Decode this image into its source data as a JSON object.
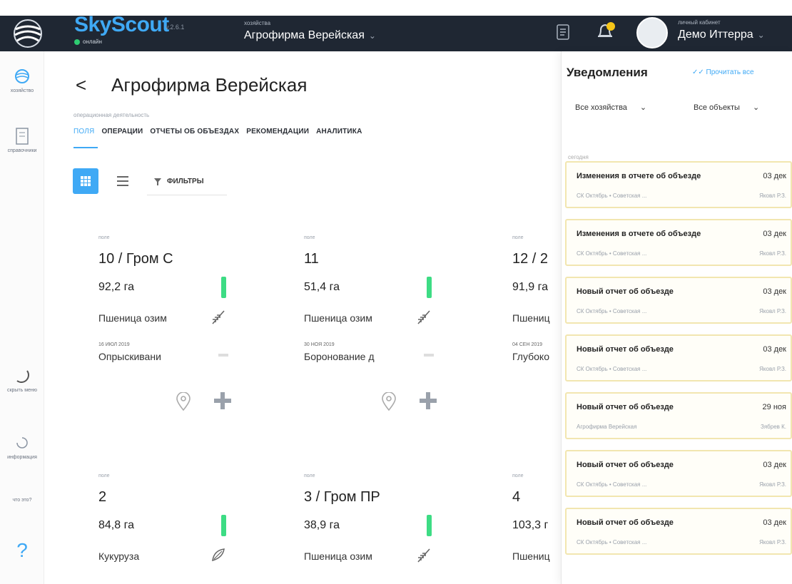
{
  "header": {
    "brand": "SkyScout",
    "version": "v.2.6.1",
    "status": "онлайн",
    "farm_caption": "хозяйства",
    "farm_name": "Агрофирма Верейская",
    "cabinet_caption": "личный кабинет",
    "cabinet_name": "Демо Иттерра"
  },
  "sidebar": {
    "items": [
      {
        "label": "хозяйство",
        "icon": "globe-icon"
      },
      {
        "label": "справочники",
        "icon": "book-icon"
      },
      {
        "label": "скрыть меню",
        "icon": "collapse-icon"
      },
      {
        "label": "информация",
        "icon": "info-icon"
      },
      {
        "label": "что это?",
        "icon": "help-icon"
      }
    ],
    "help_glyph": "?"
  },
  "page": {
    "back_glyph": "<",
    "title": "Агрофирма Верейская",
    "subcaption": "операционная деятельность",
    "tabs": [
      {
        "label": "ПОЛЯ",
        "active": true
      },
      {
        "label": "ОПЕРАЦИИ"
      },
      {
        "label": "ОТЧЕТЫ ОБ ОБЪЕЗДАХ"
      },
      {
        "label": "РЕКОМЕНДАЦИИ"
      },
      {
        "label": "АНАЛИТИКА"
      }
    ],
    "filters_label": "ФИЛЬТРЫ",
    "accent_color": "#3fa9f5",
    "ndvi_color": "#3ddc84"
  },
  "fields": [
    {
      "label": "поле",
      "name": "10 / Гром С",
      "area": "92,2 га",
      "crop": "Пшеница озим",
      "crop_icon": "wheat-icon",
      "date": "16 ИЮЛ 2019",
      "operation": "Опрыскивани"
    },
    {
      "label": "поле",
      "name": "11",
      "area": "51,4 га",
      "crop": "Пшеница озим",
      "crop_icon": "wheat-icon",
      "date": "30 НОЯ 2019",
      "operation": "Боронование д"
    },
    {
      "label": "поле",
      "name": "12 / 2",
      "area": "91,9 га",
      "crop": "Пшениц",
      "crop_icon": "wheat-icon",
      "date": "04 СЕН 2019",
      "operation": "Глубоко"
    },
    {
      "label": "поле",
      "name": "2",
      "area": "84,8 га",
      "crop": "Кукуруза",
      "crop_icon": "corn-icon"
    },
    {
      "label": "поле",
      "name": "3 / Гром ПР",
      "area": "38,9 га",
      "crop": "Пшеница озим",
      "crop_icon": "wheat-icon"
    },
    {
      "label": "поле",
      "name": "4",
      "area": "103,3 г",
      "crop": "Пшениц",
      "crop_icon": "wheat-icon"
    }
  ],
  "notifications": {
    "title": "Уведомления",
    "read_all": "Прочитать все",
    "filter_farms": "Все хозяйства",
    "filter_objects": "Все объекты",
    "group_label": "сегодня",
    "items": [
      {
        "title": "Изменения в отчете об объезде",
        "date": "03 дек",
        "source": "СК Октябрь • Советская ...",
        "author": "Яковл Р.З."
      },
      {
        "title": "Изменения в отчете об объезде",
        "date": "03 дек",
        "source": "СК Октябрь • Советская ...",
        "author": "Яковл Р.З."
      },
      {
        "title": "Новый отчет об объезде",
        "date": "03 дек",
        "source": "СК Октябрь • Советская ...",
        "author": "Яковл Р.З."
      },
      {
        "title": "Новый отчет об объезде",
        "date": "03 дек",
        "source": "СК Октябрь • Советская ...",
        "author": "Яковл Р.З."
      },
      {
        "title": "Новый отчет об объезде",
        "date": "29 ноя",
        "source": "Агрофирма Верейская",
        "author": "Зябрев К."
      },
      {
        "title": "Новый отчет об объезде",
        "date": "03 дек",
        "source": "СК Октябрь • Советская ...",
        "author": "Яковл Р.З."
      },
      {
        "title": "Новый отчет об объезде",
        "date": "03 дек",
        "source": "СК Октябрь • Советская ...",
        "author": "Яковл Р.З."
      }
    ]
  }
}
